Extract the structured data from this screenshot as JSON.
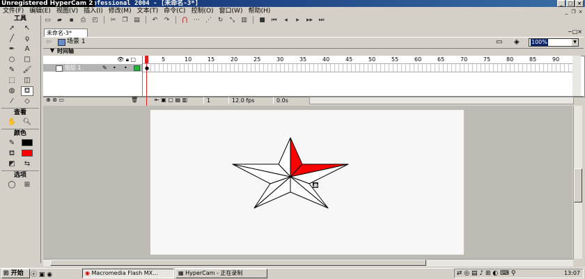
{
  "titlebar": {
    "hypercam_stamp": "Unregistered HyperCam 2",
    "title": "rofessional 2004 - [未命名-3*]"
  },
  "menubar": {
    "items": [
      "文件(F)",
      "编辑(E)",
      "视图(V)",
      "插入(I)",
      "修改(M)",
      "文本(T)",
      "命令(C)",
      "控制(O)",
      "窗口(W)",
      "帮助(H)"
    ]
  },
  "tools": {
    "title": "工具",
    "view_title": "查看",
    "color_title": "颜色",
    "options_title": "选项",
    "stroke_color": "#000000",
    "fill_color": "#ff0000"
  },
  "document": {
    "tab": "未命名-3*",
    "scene": "场景 1",
    "zoom": "100%"
  },
  "timeline": {
    "title": "时间轴",
    "frame_numbers": [
      "1",
      "5",
      "10",
      "15",
      "20",
      "25",
      "30",
      "35",
      "40",
      "45",
      "50",
      "55",
      "60",
      "65",
      "70",
      "75",
      "80",
      "85",
      "90"
    ],
    "layer_name": "图层 1",
    "current_frame": "1",
    "fps": "12.0 fps",
    "elapsed": "0.0s"
  },
  "taskbar": {
    "start": "开始",
    "tasks": [
      "Macromedia Flash MX...",
      "HyperCam - 正在录制"
    ],
    "clock": "13:07"
  }
}
